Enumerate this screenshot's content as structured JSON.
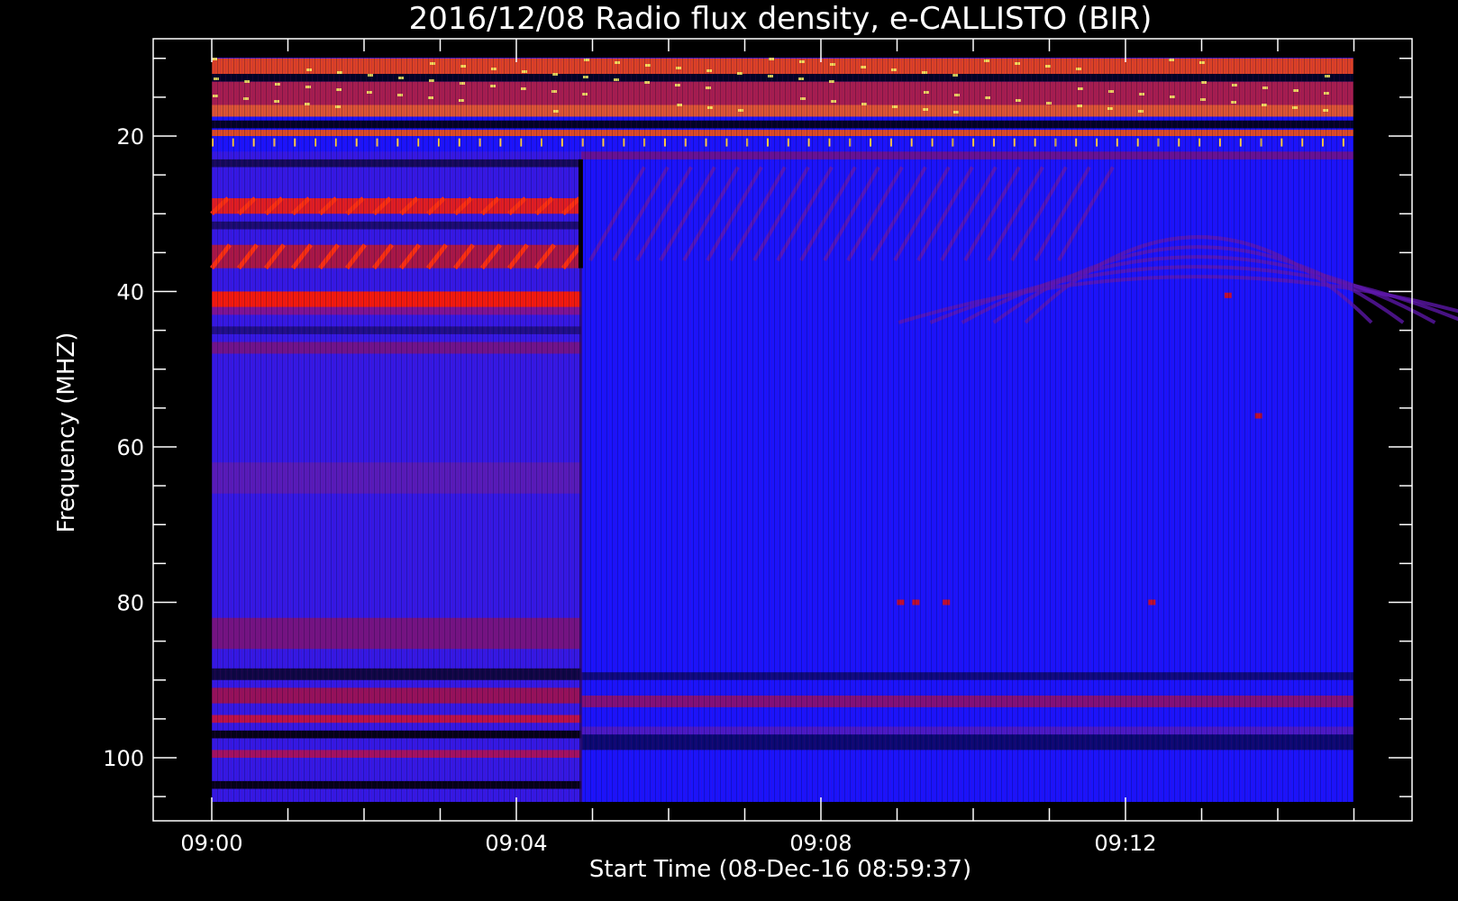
{
  "chart_data": {
    "type": "heatmap",
    "title": "2016/12/08  Radio flux density, e-CALLISTO (BIR)",
    "xlabel": "Start Time (08-Dec-16 08:59:37)",
    "ylabel": "Frequency (MHZ)",
    "x_ticks": [
      "09:00",
      "09:04",
      "09:08",
      "09:12"
    ],
    "y_ticks": [
      20,
      40,
      60,
      80,
      100
    ],
    "y_inverted": true,
    "colormap": "black-blue-red-yellow-white",
    "features": [
      {
        "label": "strong interference (low-frequency band)",
        "freq_range": [
          10,
          22
        ]
      },
      {
        "label": "sweeping drift stripes",
        "time_range": [
          "09:00",
          "09:14.9"
        ],
        "freq_range": [
          24,
          40
        ]
      },
      {
        "label": "abrupt change in background level",
        "time": "09:04.8"
      },
      {
        "label": "strong horizontal band before change",
        "freq": 41
      },
      {
        "label": "interference bands",
        "freq_range": [
          88,
          106
        ]
      }
    ]
  },
  "colors": {
    "background": "#000000",
    "foreground": "#ffffff",
    "spectrum_base": "#1a14ff",
    "spectrum_hot": "#ff2a00",
    "spectrum_max": "#ffff66"
  }
}
